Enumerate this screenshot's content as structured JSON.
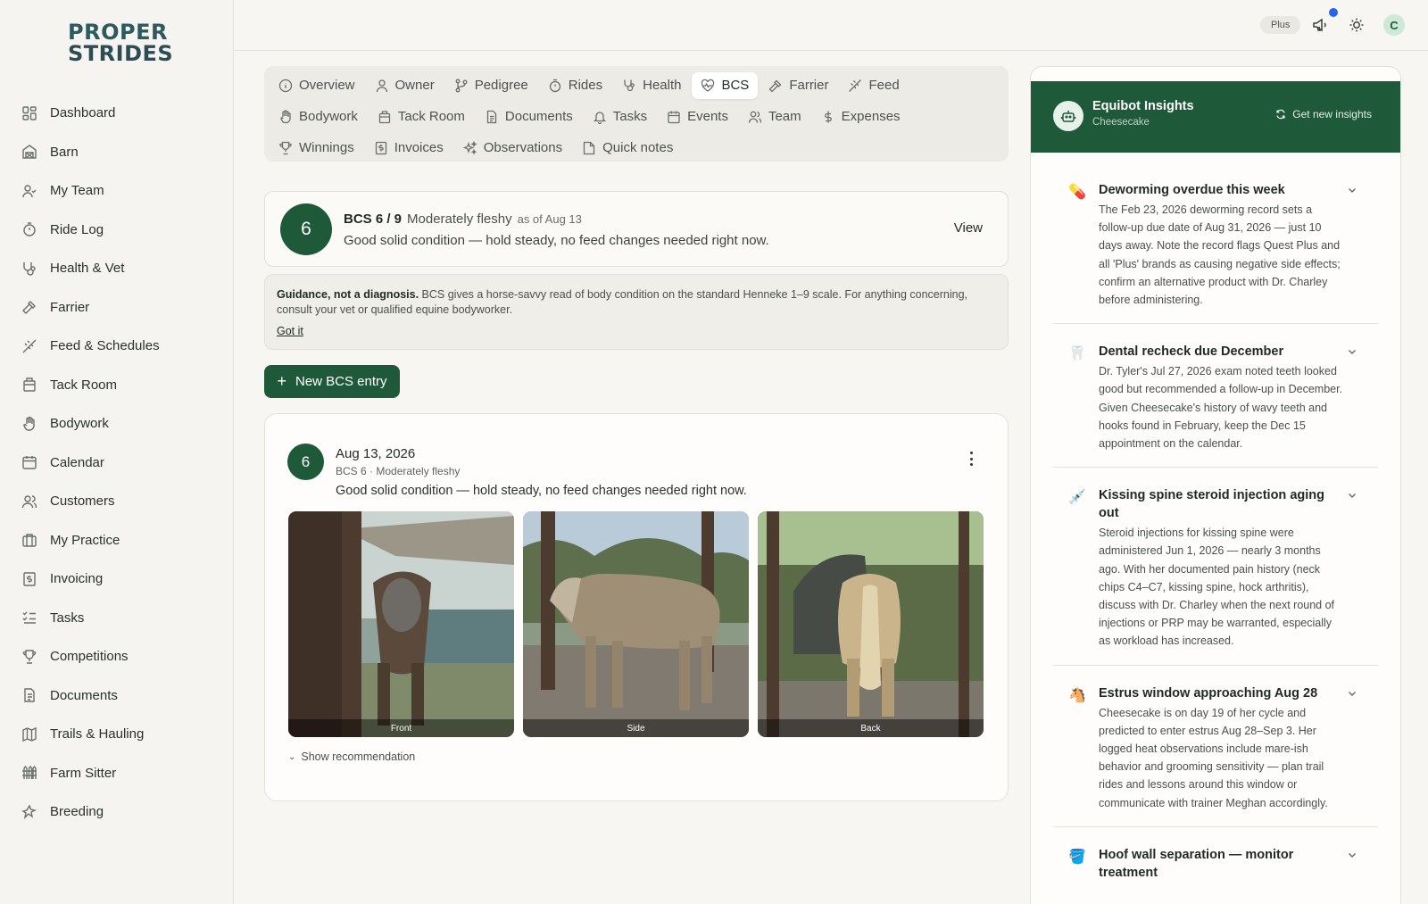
{
  "brand": {
    "line1": "PROPER",
    "line2": "STRIDES"
  },
  "sidebar": {
    "items": [
      {
        "label": "Dashboard",
        "icon": "dashboard-icon"
      },
      {
        "label": "Barn",
        "icon": "barn-icon"
      },
      {
        "label": "My Team",
        "icon": "team-icon"
      },
      {
        "label": "Ride Log",
        "icon": "timer-icon"
      },
      {
        "label": "Health & Vet",
        "icon": "stethoscope-icon"
      },
      {
        "label": "Farrier",
        "icon": "hammer-icon"
      },
      {
        "label": "Feed & Schedules",
        "icon": "wheat-icon"
      },
      {
        "label": "Tack Room",
        "icon": "tack-icon"
      },
      {
        "label": "Bodywork",
        "icon": "hand-icon"
      },
      {
        "label": "Calendar",
        "icon": "calendar-icon"
      },
      {
        "label": "Customers",
        "icon": "customers-icon"
      },
      {
        "label": "My Practice",
        "icon": "briefcase-icon"
      },
      {
        "label": "Invoicing",
        "icon": "invoice-icon"
      },
      {
        "label": "Tasks",
        "icon": "checklist-icon"
      },
      {
        "label": "Competitions",
        "icon": "trophy-icon"
      },
      {
        "label": "Documents",
        "icon": "document-icon"
      },
      {
        "label": "Trails & Hauling",
        "icon": "map-icon"
      },
      {
        "label": "Farm Sitter",
        "icon": "fence-icon"
      },
      {
        "label": "Breeding",
        "icon": "breeding-icon"
      }
    ]
  },
  "topbar": {
    "plan_badge": "Plus",
    "avatar_initial": "C"
  },
  "tabs": {
    "rows": [
      [
        {
          "label": "Overview"
        },
        {
          "label": "Owner"
        },
        {
          "label": "Pedigree"
        },
        {
          "label": "Rides"
        },
        {
          "label": "Health"
        },
        {
          "label": "BCS",
          "active": true
        },
        {
          "label": "Farrier"
        },
        {
          "label": "Feed"
        }
      ],
      [
        {
          "label": "Bodywork"
        },
        {
          "label": "Tack Room"
        },
        {
          "label": "Documents"
        },
        {
          "label": "Tasks"
        },
        {
          "label": "Events"
        },
        {
          "label": "Team"
        },
        {
          "label": "Expenses"
        }
      ],
      [
        {
          "label": "Winnings"
        },
        {
          "label": "Invoices"
        },
        {
          "label": "Observations"
        },
        {
          "label": "Quick notes"
        }
      ]
    ]
  },
  "summary": {
    "score": "6",
    "score_label": "BCS 6 / 9",
    "descriptor": "Moderately fleshy",
    "as_of": "as of Aug 13",
    "message": "Good solid condition — hold steady, no feed changes needed right now.",
    "view_label": "View"
  },
  "guidance": {
    "bold": "Guidance, not a diagnosis.",
    "text": " BCS gives a horse-savvy read of body condition on the standard Henneke 1–9 scale. For anything concerning, consult your vet or qualified equine bodyworker.",
    "dismiss_label": "Got it"
  },
  "new_entry_button": "New BCS entry",
  "entry": {
    "score": "6",
    "date": "Aug 13, 2026",
    "subtitle": "BCS 6 · Moderately fleshy",
    "text": "Good solid condition — hold steady, no feed changes needed right now.",
    "photos": [
      {
        "caption": "Front"
      },
      {
        "caption": "Side"
      },
      {
        "caption": "Back"
      }
    ],
    "show_recommendation": "Show recommendation"
  },
  "insights": {
    "title": "Equibot Insights",
    "subtitle": "Cheesecake",
    "refresh_label": "Get new insights",
    "items": [
      {
        "emoji": "💊",
        "title": "Deworming overdue this week",
        "body": "The Feb 23, 2026 deworming record sets a follow-up due date of Aug 31, 2026 — just 10 days away. Note the record flags Quest Plus and all 'Plus' brands as causing negative side effects; confirm an alternative product with Dr. Charley before administering."
      },
      {
        "emoji": "🦷",
        "title": "Dental recheck due December",
        "body": "Dr. Tyler's Jul 27, 2026 exam noted teeth looked good but recommended a follow-up in December. Given Cheesecake's history of wavy teeth and hooks found in February, keep the Dec 15 appointment on the calendar."
      },
      {
        "emoji": "💉",
        "title": "Kissing spine steroid injection aging out",
        "body": "Steroid injections for kissing spine were administered Jun 1, 2026 — nearly 3 months ago. With her documented pain history (neck chips C4–C7, kissing spine, hock arthritis), discuss with Dr. Charley when the next round of injections or PRP may be warranted, especially as workload has increased."
      },
      {
        "emoji": "🐴",
        "title": "Estrus window approaching Aug 28",
        "body": "Cheesecake is on day 19 of her cycle and predicted to enter estrus Aug 28–Sep 3. Her logged heat observations include mare-ish behavior and grooming sensitivity — plan trail rides and lessons around this window or communicate with trainer Meghan accordingly."
      },
      {
        "emoji": "🪣",
        "title": "Hoof wall separation — monitor treatment",
        "body": ""
      }
    ]
  },
  "colors": {
    "brand_green": "#1e5a3a",
    "notification_dot": "#2563eb"
  }
}
